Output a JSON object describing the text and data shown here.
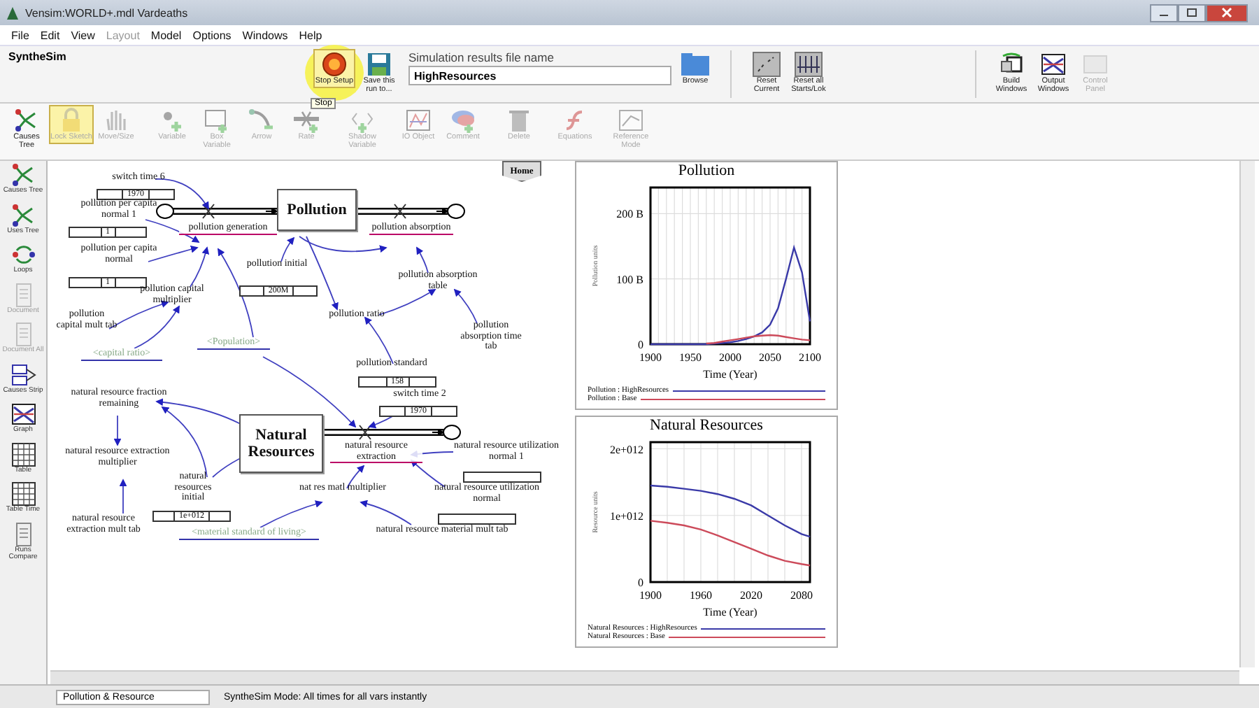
{
  "window": {
    "title": "Vensim:WORLD+.mdl Vardeaths"
  },
  "menu": [
    {
      "label": "File",
      "disabled": false
    },
    {
      "label": "Edit",
      "disabled": false
    },
    {
      "label": "View",
      "disabled": false
    },
    {
      "label": "Layout",
      "disabled": true
    },
    {
      "label": "Model",
      "disabled": false
    },
    {
      "label": "Options",
      "disabled": false
    },
    {
      "label": "Windows",
      "disabled": false
    },
    {
      "label": "Help",
      "disabled": false
    }
  ],
  "synthesim_bar": {
    "title": "SyntheSim",
    "left_buttons": [
      {
        "label": "Stop Setup",
        "selected": true
      },
      {
        "label": "Save this run to...",
        "selected": false
      }
    ],
    "tooltip": "Stop",
    "results_file": {
      "label": "Simulation results file name",
      "value": "HighResources"
    },
    "browse": "Browse",
    "reset_buttons": [
      {
        "label": "Reset Current"
      },
      {
        "label": "Reset all Starts/Lok"
      }
    ],
    "window_buttons": [
      {
        "label": "Build Windows",
        "disabled": false
      },
      {
        "label": "Output Windows",
        "disabled": false
      },
      {
        "label": "Control Panel",
        "disabled": true
      }
    ]
  },
  "sketch_tools": [
    {
      "label": "Causes Tree",
      "disabled": false,
      "selected": false
    },
    {
      "label": "Lock Sketch",
      "disabled": true,
      "selected": true
    },
    {
      "label": "Move/Size",
      "disabled": true,
      "selected": false
    },
    {
      "label": "Variable",
      "disabled": true,
      "selected": false
    },
    {
      "label": "Box Variable",
      "disabled": true,
      "selected": false
    },
    {
      "label": "Arrow",
      "disabled": true,
      "selected": false
    },
    {
      "label": "Rate",
      "disabled": true,
      "selected": false
    },
    {
      "label": "Shadow Variable",
      "disabled": true,
      "selected": false
    },
    {
      "label": "IO Object",
      "disabled": true,
      "selected": false
    },
    {
      "label": "Comment",
      "disabled": true,
      "selected": false
    },
    {
      "label": "Delete",
      "disabled": true,
      "selected": false
    },
    {
      "label": "Equations",
      "disabled": true,
      "selected": false
    },
    {
      "label": "Reference Mode",
      "disabled": true,
      "selected": false
    }
  ],
  "sidebar": [
    {
      "label": "Causes Tree",
      "disabled": false
    },
    {
      "label": "Uses Tree",
      "disabled": false
    },
    {
      "label": "Loops",
      "disabled": false
    },
    {
      "label": "Document",
      "disabled": true
    },
    {
      "label": "Document All",
      "disabled": true
    },
    {
      "label": "Causes Strip",
      "disabled": false
    },
    {
      "label": "Graph",
      "disabled": false
    },
    {
      "label": "Table",
      "disabled": false
    },
    {
      "label": "Table Time",
      "disabled": false
    },
    {
      "label": "Runs Compare",
      "disabled": false
    }
  ],
  "diagram": {
    "home_button": "Home",
    "nodes": [
      {
        "kind": "aux",
        "label": "switch time 6",
        "slider": true,
        "slider_value": "1970"
      },
      {
        "kind": "aux",
        "label": "pollution per capita normal 1",
        "slider": true,
        "slider_value": "1"
      },
      {
        "kind": "aux",
        "label": "pollution per capita normal",
        "slider": true,
        "slider_value": "1"
      },
      {
        "kind": "rate",
        "label": "pollution generation"
      },
      {
        "kind": "stock",
        "label": "Pollution"
      },
      {
        "kind": "rate",
        "label": "pollution absorption"
      },
      {
        "kind": "aux",
        "label": "pollution initial",
        "slider": true,
        "slider_value": "200M"
      },
      {
        "kind": "aux",
        "label": "pollution capital multiplier"
      },
      {
        "kind": "aux",
        "label": "pollution capital mult tab"
      },
      {
        "kind": "shadow",
        "label": "<capital ratio>"
      },
      {
        "kind": "shadow",
        "label": "<Population>"
      },
      {
        "kind": "aux",
        "label": "pollution ratio"
      },
      {
        "kind": "aux",
        "label": "pollution absorption table"
      },
      {
        "kind": "aux",
        "label": "pollution absorption time tab"
      },
      {
        "kind": "aux",
        "label": "pollution standard",
        "slider": true,
        "slider_value": "158"
      },
      {
        "kind": "aux",
        "label": "natural resource fraction remaining"
      },
      {
        "kind": "stock",
        "label": "Natural Resources"
      },
      {
        "kind": "aux",
        "label": "switch time 2",
        "slider": true,
        "slider_value": "1970"
      },
      {
        "kind": "rate",
        "label": "natural resource extraction"
      },
      {
        "kind": "aux",
        "label": "natural resource utilization normal 1",
        "slider": true
      },
      {
        "kind": "aux",
        "label": "natural resource extraction multiplier"
      },
      {
        "kind": "aux",
        "label": "natural resources initial",
        "slider": true,
        "slider_value": "1e+012"
      },
      {
        "kind": "aux",
        "label": "natural resource extraction mult tab"
      },
      {
        "kind": "aux",
        "label": "nat res matl multiplier"
      },
      {
        "kind": "aux",
        "label": "natural resource utilization normal",
        "slider": true
      },
      {
        "kind": "shadow",
        "label": "<material standard of living>"
      },
      {
        "kind": "aux",
        "label": "natural resource material mult tab"
      }
    ]
  },
  "charts": [
    {
      "chart_data": {
        "type": "line",
        "grid": true,
        "title": "Pollution",
        "xlabel": "Time (Year)",
        "ylabel": "Pollution units",
        "x": [
          1900,
          1910,
          1920,
          1930,
          1940,
          1950,
          1960,
          1970,
          1980,
          1990,
          2000,
          2010,
          2020,
          2030,
          2040,
          2050,
          2060,
          2070,
          2080,
          2090,
          2100
        ],
        "xlim": [
          1900,
          2100
        ],
        "ylim": [
          0,
          240000000000
        ],
        "xticks": [
          1900,
          1950,
          2000,
          2050,
          2100
        ],
        "yticks": [
          {
            "value": 0,
            "label": "0"
          },
          {
            "value": 100000000000,
            "label": "100 B"
          },
          {
            "value": 200000000000,
            "label": "200 B"
          }
        ],
        "series": [
          {
            "name": "Pollution : HighResources",
            "color": "#3a3aa8",
            "values": [
              0,
              0,
              0,
              0,
              0,
              0,
              0,
              0,
              1000000000,
              2000000000,
              3000000000,
              5000000000,
              8000000000,
              12000000000,
              18000000000,
              30000000000,
              55000000000,
              100000000000,
              148000000000,
              110000000000,
              35000000000
            ]
          },
          {
            "name": "Pollution : Base",
            "color": "#cc4a5a",
            "values": [
              null,
              null,
              null,
              null,
              null,
              null,
              null,
              1000000000,
              2000000000,
              4000000000,
              6000000000,
              8000000000,
              10000000000,
              12000000000,
              13000000000,
              14000000000,
              13000000000,
              11000000000,
              9000000000,
              7000000000,
              6000000000
            ]
          }
        ]
      }
    },
    {
      "chart_data": {
        "type": "line",
        "grid": true,
        "title": "Natural Resources",
        "xlabel": "Time (Year)",
        "ylabel": "Resource units",
        "x": [
          1900,
          1920,
          1940,
          1960,
          1980,
          2000,
          2020,
          2040,
          2060,
          2080,
          2090
        ],
        "xlim": [
          1900,
          2090
        ],
        "ylim": [
          0,
          2100000000000
        ],
        "xticks": [
          1900,
          1960,
          2020,
          2080
        ],
        "yticks": [
          {
            "value": 0,
            "label": "0"
          },
          {
            "value": 1000000000000,
            "label": "1e+012"
          },
          {
            "value": 2000000000000,
            "label": "2e+012"
          }
        ],
        "series": [
          {
            "name": "Natural Resources : HighResources",
            "color": "#3a3aa8",
            "values": [
              1450000000000,
              1430000000000,
              1400000000000,
              1370000000000,
              1320000000000,
              1250000000000,
              1150000000000,
              1000000000000,
              850000000000,
              720000000000,
              680000000000
            ]
          },
          {
            "name": "Natural Resources : Base",
            "color": "#cc4a5a",
            "values": [
              920000000000,
              890000000000,
              850000000000,
              790000000000,
              700000000000,
              600000000000,
              500000000000,
              400000000000,
              320000000000,
              270000000000,
              250000000000
            ]
          }
        ]
      }
    }
  ],
  "status_bar": {
    "view": "Pollution & Resource",
    "message": "SyntheSim Mode: All times for all vars instantly"
  }
}
